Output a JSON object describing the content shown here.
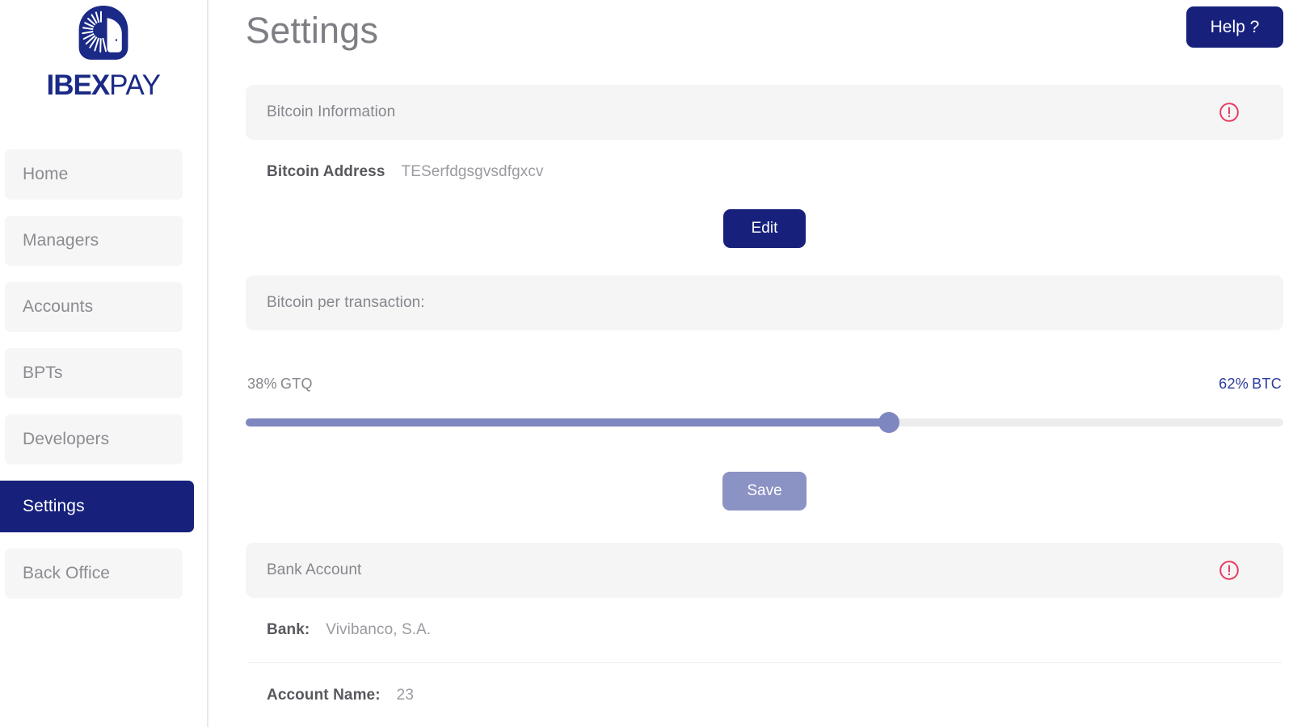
{
  "brand": {
    "name_bold": "IBEX",
    "name_light": "PAY",
    "logo_icon": "ibex-head-emblem",
    "color": "#1b2a86"
  },
  "sidebar": {
    "items": [
      {
        "label": "Home",
        "active": false
      },
      {
        "label": "Managers",
        "active": false
      },
      {
        "label": "Accounts",
        "active": false
      },
      {
        "label": "BPTs",
        "active": false
      },
      {
        "label": "Developers",
        "active": false
      },
      {
        "label": "Settings",
        "active": true
      },
      {
        "label": "Back Office",
        "active": false
      }
    ]
  },
  "header": {
    "title": "Settings",
    "help_label": "Help ?"
  },
  "bitcoin_information": {
    "section_title": "Bitcoin Information",
    "alert_icon": "alert-circle-icon",
    "alert_color": "#e8395e",
    "address_label": "Bitcoin Address",
    "address_value": "TESerfdgsgvsdfgxcv",
    "edit_label": "Edit"
  },
  "bitcoin_per_transaction": {
    "section_title": "Bitcoin per transaction:",
    "left_percent": "38%",
    "left_currency": "GTQ",
    "right_percent": "62%",
    "right_currency": "BTC",
    "slider_value": 62,
    "slider_min": 0,
    "slider_max": 100,
    "save_label": "Save",
    "save_disabled": true,
    "fill_color": "#7f87c0",
    "track_color": "#ececec"
  },
  "bank_account": {
    "section_title": "Bank Account",
    "alert_icon": "alert-circle-icon",
    "rows": [
      {
        "label": "Bank:",
        "value": "Vivibanco, S.A."
      },
      {
        "label": "Account Name:",
        "value": "23"
      }
    ]
  }
}
